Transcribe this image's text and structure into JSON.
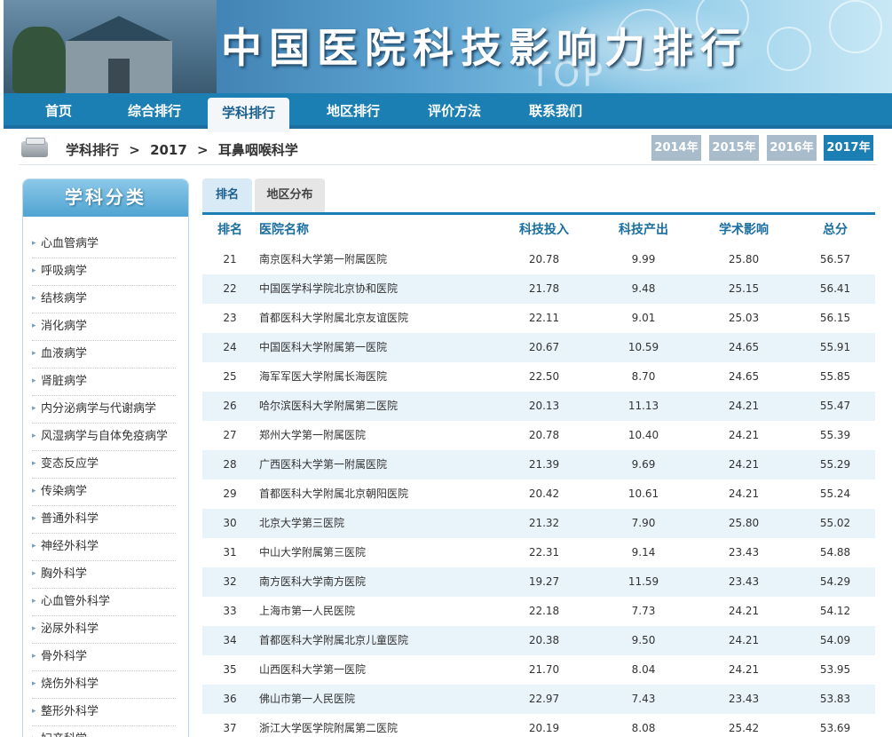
{
  "banner": {
    "title": "中国医院科技影响力排行",
    "watermark": "TOP"
  },
  "nav": {
    "items": [
      {
        "label": "首页"
      },
      {
        "label": "综合排行"
      },
      {
        "label": "学科排行",
        "active": true
      },
      {
        "label": "地区排行"
      },
      {
        "label": "评价方法"
      },
      {
        "label": "联系我们"
      }
    ]
  },
  "breadcrumb": {
    "section": "学科排行",
    "year": "2017",
    "subject": "耳鼻咽喉科学",
    "sep": ">"
  },
  "years": [
    {
      "label": "2014年"
    },
    {
      "label": "2015年"
    },
    {
      "label": "2016年"
    },
    {
      "label": "2017年",
      "active": true
    }
  ],
  "sidebar": {
    "title": "学科分类",
    "items": [
      {
        "label": "心血管病学"
      },
      {
        "label": "呼吸病学"
      },
      {
        "label": "结核病学"
      },
      {
        "label": "消化病学"
      },
      {
        "label": "血液病学"
      },
      {
        "label": "肾脏病学"
      },
      {
        "label": "内分泌病学与代谢病学"
      },
      {
        "label": "风湿病学与自体免疫病学"
      },
      {
        "label": "变态反应学"
      },
      {
        "label": "传染病学"
      },
      {
        "label": "普通外科学"
      },
      {
        "label": "神经外科学"
      },
      {
        "label": "胸外科学"
      },
      {
        "label": "心血管外科学"
      },
      {
        "label": "泌尿外科学"
      },
      {
        "label": "骨外科学"
      },
      {
        "label": "烧伤外科学"
      },
      {
        "label": "整形外科学"
      },
      {
        "label": "妇产科学"
      }
    ]
  },
  "tabs": [
    {
      "label": "排名",
      "active": true
    },
    {
      "label": "地区分布"
    }
  ],
  "table": {
    "headers": [
      "排名",
      "医院名称",
      "科技投入",
      "科技产出",
      "学术影响",
      "总分"
    ],
    "rows": [
      [
        "21",
        "南京医科大学第一附属医院",
        "20.78",
        "9.99",
        "25.80",
        "56.57"
      ],
      [
        "22",
        "中国医学科学院北京协和医院",
        "21.78",
        "9.48",
        "25.15",
        "56.41"
      ],
      [
        "23",
        "首都医科大学附属北京友谊医院",
        "22.11",
        "9.01",
        "25.03",
        "56.15"
      ],
      [
        "24",
        "中国医科大学附属第一医院",
        "20.67",
        "10.59",
        "24.65",
        "55.91"
      ],
      [
        "25",
        "海军军医大学附属长海医院",
        "22.50",
        "8.70",
        "24.65",
        "55.85"
      ],
      [
        "26",
        "哈尔滨医科大学附属第二医院",
        "20.13",
        "11.13",
        "24.21",
        "55.47"
      ],
      [
        "27",
        "郑州大学第一附属医院",
        "20.78",
        "10.40",
        "24.21",
        "55.39"
      ],
      [
        "28",
        "广西医科大学第一附属医院",
        "21.39",
        "9.69",
        "24.21",
        "55.29"
      ],
      [
        "29",
        "首都医科大学附属北京朝阳医院",
        "20.42",
        "10.61",
        "24.21",
        "55.24"
      ],
      [
        "30",
        "北京大学第三医院",
        "21.32",
        "7.90",
        "25.80",
        "55.02"
      ],
      [
        "31",
        "中山大学附属第三医院",
        "22.31",
        "9.14",
        "23.43",
        "54.88"
      ],
      [
        "32",
        "南方医科大学南方医院",
        "19.27",
        "11.59",
        "23.43",
        "54.29"
      ],
      [
        "33",
        "上海市第一人民医院",
        "22.18",
        "7.73",
        "24.21",
        "54.12"
      ],
      [
        "34",
        "首都医科大学附属北京儿童医院",
        "20.38",
        "9.50",
        "24.21",
        "54.09"
      ],
      [
        "35",
        "山西医科大学第一医院",
        "21.70",
        "8.04",
        "24.21",
        "53.95"
      ],
      [
        "36",
        "佛山市第一人民医院",
        "22.97",
        "7.43",
        "23.43",
        "53.83"
      ],
      [
        "37",
        "浙江大学医学院附属第二医院",
        "20.19",
        "8.08",
        "25.42",
        "53.69"
      ]
    ]
  }
}
